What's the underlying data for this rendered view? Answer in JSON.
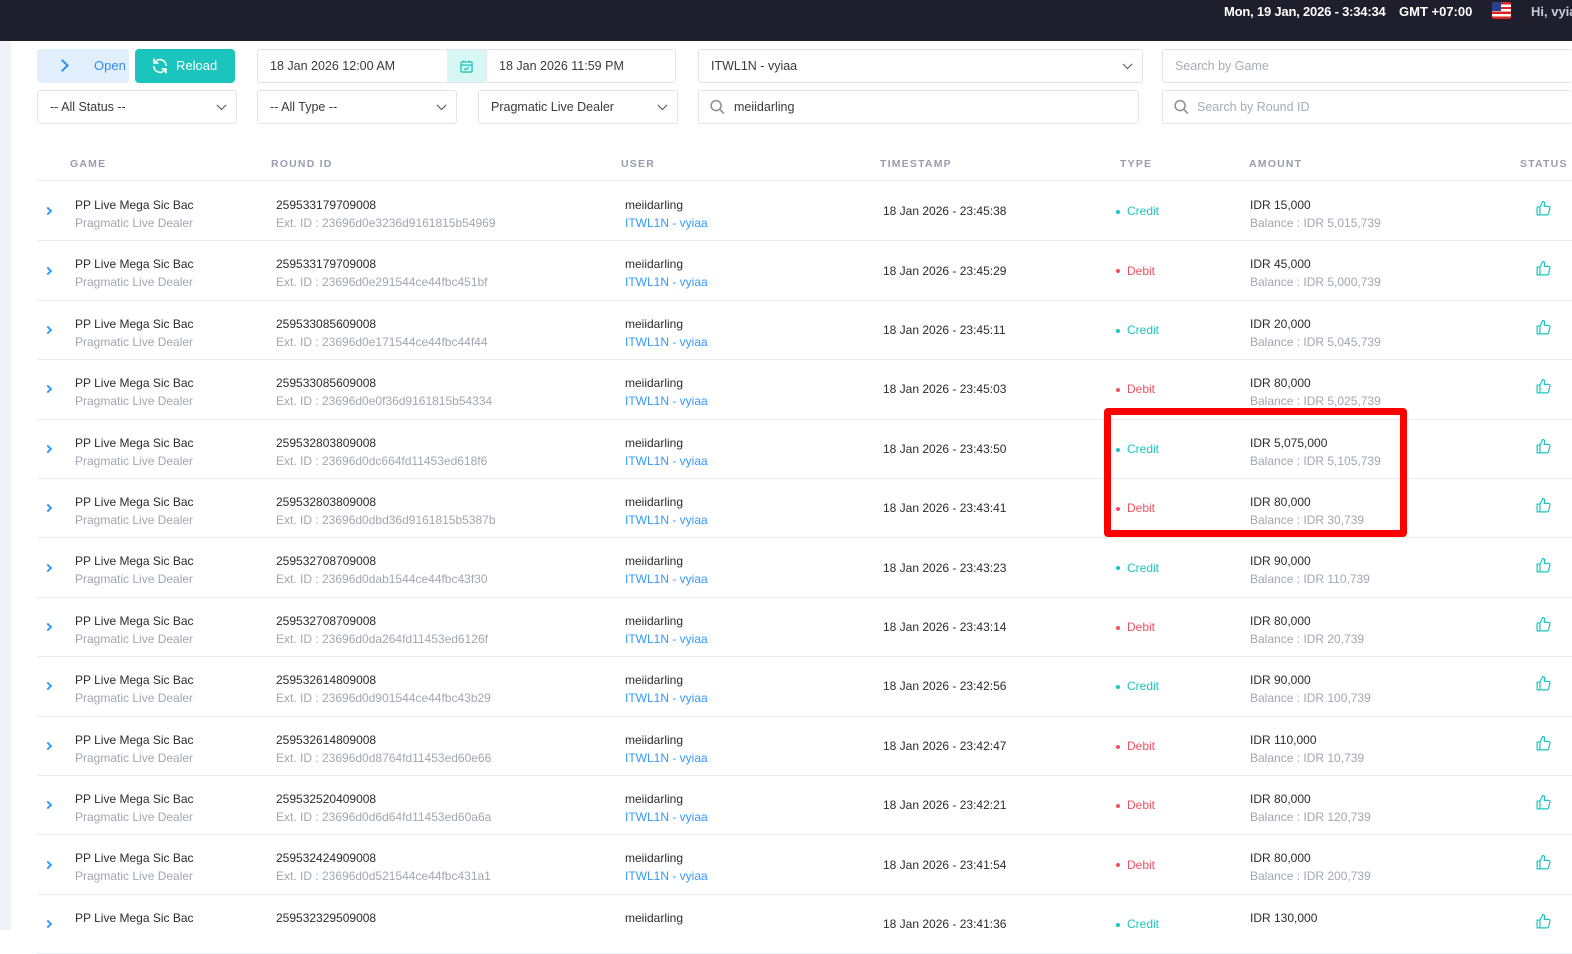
{
  "topbar": {
    "datetime": "Mon, 19 Jan, 2026 - 3:34:34",
    "timezone": "GMT +07:00",
    "greeting": "Hi, vyia"
  },
  "toolbar": {
    "open_label": "Open",
    "reload_label": "Reload",
    "date_from": "18 Jan 2026 12:00 AM",
    "date_to": "18 Jan 2026 11:59 PM",
    "agent": "ITWL1N - vyiaa",
    "search_game_placeholder": "Search by Game",
    "status_filter": "-- All Status --",
    "type_filter": "-- All Type --",
    "provider_filter": "Pragmatic Live Dealer",
    "user_search": "meiidarling",
    "round_search_placeholder": "Search by Round ID"
  },
  "table": {
    "headers": {
      "game": "GAME",
      "round_id": "ROUND ID",
      "user": "USER",
      "timestamp": "TIMESTAMP",
      "type": "TYPE",
      "amount": "AMOUNT",
      "status": "STATUS"
    },
    "rows": [
      {
        "game": "PP Live Mega Sic Bac",
        "provider": "Pragmatic Live Dealer",
        "round_id": "259533179709008",
        "ext_id": "Ext. ID : 23696d0e3236d9161815b54969",
        "user": "meiidarling",
        "agent": "ITWL1N - vyiaa",
        "timestamp": "18 Jan 2026 - 23:45:38",
        "type": "Credit",
        "amount": "IDR 15,000",
        "balance": "Balance : IDR 5,015,739"
      },
      {
        "game": "PP Live Mega Sic Bac",
        "provider": "Pragmatic Live Dealer",
        "round_id": "259533179709008",
        "ext_id": "Ext. ID : 23696d0e291544ce44fbc451bf",
        "user": "meiidarling",
        "agent": "ITWL1N - vyiaa",
        "timestamp": "18 Jan 2026 - 23:45:29",
        "type": "Debit",
        "amount": "IDR 45,000",
        "balance": "Balance : IDR 5,000,739"
      },
      {
        "game": "PP Live Mega Sic Bac",
        "provider": "Pragmatic Live Dealer",
        "round_id": "259533085609008",
        "ext_id": "Ext. ID : 23696d0e171544ce44fbc44f44",
        "user": "meiidarling",
        "agent": "ITWL1N - vyiaa",
        "timestamp": "18 Jan 2026 - 23:45:11",
        "type": "Credit",
        "amount": "IDR 20,000",
        "balance": "Balance : IDR 5,045,739"
      },
      {
        "game": "PP Live Mega Sic Bac",
        "provider": "Pragmatic Live Dealer",
        "round_id": "259533085609008",
        "ext_id": "Ext. ID : 23696d0e0f36d9161815b54334",
        "user": "meiidarling",
        "agent": "ITWL1N - vyiaa",
        "timestamp": "18 Jan 2026 - 23:45:03",
        "type": "Debit",
        "amount": "IDR 80,000",
        "balance": "Balance : IDR 5,025,739"
      },
      {
        "game": "PP Live Mega Sic Bac",
        "provider": "Pragmatic Live Dealer",
        "round_id": "259532803809008",
        "ext_id": "Ext. ID : 23696d0dc664fd11453ed618f6",
        "user": "meiidarling",
        "agent": "ITWL1N - vyiaa",
        "timestamp": "18 Jan 2026 - 23:43:50",
        "type": "Credit",
        "amount": "IDR 5,075,000",
        "balance": "Balance : IDR 5,105,739"
      },
      {
        "game": "PP Live Mega Sic Bac",
        "provider": "Pragmatic Live Dealer",
        "round_id": "259532803809008",
        "ext_id": "Ext. ID : 23696d0dbd36d9161815b5387b",
        "user": "meiidarling",
        "agent": "ITWL1N - vyiaa",
        "timestamp": "18 Jan 2026 - 23:43:41",
        "type": "Debit",
        "amount": "IDR 80,000",
        "balance": "Balance : IDR 30,739"
      },
      {
        "game": "PP Live Mega Sic Bac",
        "provider": "Pragmatic Live Dealer",
        "round_id": "259532708709008",
        "ext_id": "Ext. ID : 23696d0dab1544ce44fbc43f30",
        "user": "meiidarling",
        "agent": "ITWL1N - vyiaa",
        "timestamp": "18 Jan 2026 - 23:43:23",
        "type": "Credit",
        "amount": "IDR 90,000",
        "balance": "Balance : IDR 110,739"
      },
      {
        "game": "PP Live Mega Sic Bac",
        "provider": "Pragmatic Live Dealer",
        "round_id": "259532708709008",
        "ext_id": "Ext. ID : 23696d0da264fd11453ed6126f",
        "user": "meiidarling",
        "agent": "ITWL1N - vyiaa",
        "timestamp": "18 Jan 2026 - 23:43:14",
        "type": "Debit",
        "amount": "IDR 80,000",
        "balance": "Balance : IDR 20,739"
      },
      {
        "game": "PP Live Mega Sic Bac",
        "provider": "Pragmatic Live Dealer",
        "round_id": "259532614809008",
        "ext_id": "Ext. ID : 23696d0d901544ce44fbc43b29",
        "user": "meiidarling",
        "agent": "ITWL1N - vyiaa",
        "timestamp": "18 Jan 2026 - 23:42:56",
        "type": "Credit",
        "amount": "IDR 90,000",
        "balance": "Balance : IDR 100,739"
      },
      {
        "game": "PP Live Mega Sic Bac",
        "provider": "Pragmatic Live Dealer",
        "round_id": "259532614809008",
        "ext_id": "Ext. ID : 23696d0d8764fd11453ed60e66",
        "user": "meiidarling",
        "agent": "ITWL1N - vyiaa",
        "timestamp": "18 Jan 2026 - 23:42:47",
        "type": "Debit",
        "amount": "IDR 110,000",
        "balance": "Balance : IDR 10,739"
      },
      {
        "game": "PP Live Mega Sic Bac",
        "provider": "Pragmatic Live Dealer",
        "round_id": "259532520409008",
        "ext_id": "Ext. ID : 23696d0d6d64fd11453ed60a6a",
        "user": "meiidarling",
        "agent": "ITWL1N - vyiaa",
        "timestamp": "18 Jan 2026 - 23:42:21",
        "type": "Debit",
        "amount": "IDR 80,000",
        "balance": "Balance : IDR 120,739"
      },
      {
        "game": "PP Live Mega Sic Bac",
        "provider": "Pragmatic Live Dealer",
        "round_id": "259532424909008",
        "ext_id": "Ext. ID : 23696d0d521544ce44fbc431a1",
        "user": "meiidarling",
        "agent": "ITWL1N - vyiaa",
        "timestamp": "18 Jan 2026 - 23:41:54",
        "type": "Debit",
        "amount": "IDR 80,000",
        "balance": "Balance : IDR 200,739"
      },
      {
        "game": "PP Live Mega Sic Bac",
        "provider": "",
        "round_id": "259532329509008",
        "ext_id": "",
        "user": "meiidarling",
        "agent": "",
        "timestamp": "18 Jan 2026 - 23:41:36",
        "type": "Credit",
        "amount": "IDR 130,000",
        "balance": ""
      }
    ]
  },
  "icons": {
    "open": "chevron-right-icon",
    "reload": "refresh-icon",
    "calendar": "calendar-icon",
    "search": "search-icon",
    "status": "thumbs-up-icon",
    "flag": "us-flag-icon"
  },
  "colors": {
    "credit": "#1bc5bd",
    "debit": "#f64e60",
    "link": "#3699ff",
    "highlight": "#ff0000",
    "topbar": "#1e1e2d"
  }
}
